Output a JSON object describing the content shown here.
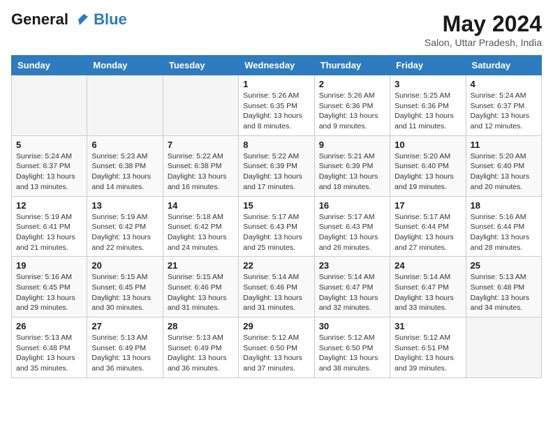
{
  "logo": {
    "line1": "General",
    "line2": "Blue"
  },
  "title": "May 2024",
  "location": "Salon, Uttar Pradesh, India",
  "days_of_week": [
    "Sunday",
    "Monday",
    "Tuesday",
    "Wednesday",
    "Thursday",
    "Friday",
    "Saturday"
  ],
  "weeks": [
    [
      {
        "day": "",
        "sunrise": "",
        "sunset": "",
        "daylight": ""
      },
      {
        "day": "",
        "sunrise": "",
        "sunset": "",
        "daylight": ""
      },
      {
        "day": "",
        "sunrise": "",
        "sunset": "",
        "daylight": ""
      },
      {
        "day": "1",
        "sunrise": "Sunrise: 5:26 AM",
        "sunset": "Sunset: 6:35 PM",
        "daylight": "Daylight: 13 hours and 8 minutes."
      },
      {
        "day": "2",
        "sunrise": "Sunrise: 5:26 AM",
        "sunset": "Sunset: 6:36 PM",
        "daylight": "Daylight: 13 hours and 9 minutes."
      },
      {
        "day": "3",
        "sunrise": "Sunrise: 5:25 AM",
        "sunset": "Sunset: 6:36 PM",
        "daylight": "Daylight: 13 hours and 11 minutes."
      },
      {
        "day": "4",
        "sunrise": "Sunrise: 5:24 AM",
        "sunset": "Sunset: 6:37 PM",
        "daylight": "Daylight: 13 hours and 12 minutes."
      }
    ],
    [
      {
        "day": "5",
        "sunrise": "Sunrise: 5:24 AM",
        "sunset": "Sunset: 6:37 PM",
        "daylight": "Daylight: 13 hours and 13 minutes."
      },
      {
        "day": "6",
        "sunrise": "Sunrise: 5:23 AM",
        "sunset": "Sunset: 6:38 PM",
        "daylight": "Daylight: 13 hours and 14 minutes."
      },
      {
        "day": "7",
        "sunrise": "Sunrise: 5:22 AM",
        "sunset": "Sunset: 6:38 PM",
        "daylight": "Daylight: 13 hours and 16 minutes."
      },
      {
        "day": "8",
        "sunrise": "Sunrise: 5:22 AM",
        "sunset": "Sunset: 6:39 PM",
        "daylight": "Daylight: 13 hours and 17 minutes."
      },
      {
        "day": "9",
        "sunrise": "Sunrise: 5:21 AM",
        "sunset": "Sunset: 6:39 PM",
        "daylight": "Daylight: 13 hours and 18 minutes."
      },
      {
        "day": "10",
        "sunrise": "Sunrise: 5:20 AM",
        "sunset": "Sunset: 6:40 PM",
        "daylight": "Daylight: 13 hours and 19 minutes."
      },
      {
        "day": "11",
        "sunrise": "Sunrise: 5:20 AM",
        "sunset": "Sunset: 6:40 PM",
        "daylight": "Daylight: 13 hours and 20 minutes."
      }
    ],
    [
      {
        "day": "12",
        "sunrise": "Sunrise: 5:19 AM",
        "sunset": "Sunset: 6:41 PM",
        "daylight": "Daylight: 13 hours and 21 minutes."
      },
      {
        "day": "13",
        "sunrise": "Sunrise: 5:19 AM",
        "sunset": "Sunset: 6:42 PM",
        "daylight": "Daylight: 13 hours and 22 minutes."
      },
      {
        "day": "14",
        "sunrise": "Sunrise: 5:18 AM",
        "sunset": "Sunset: 6:42 PM",
        "daylight": "Daylight: 13 hours and 24 minutes."
      },
      {
        "day": "15",
        "sunrise": "Sunrise: 5:17 AM",
        "sunset": "Sunset: 6:43 PM",
        "daylight": "Daylight: 13 hours and 25 minutes."
      },
      {
        "day": "16",
        "sunrise": "Sunrise: 5:17 AM",
        "sunset": "Sunset: 6:43 PM",
        "daylight": "Daylight: 13 hours and 26 minutes."
      },
      {
        "day": "17",
        "sunrise": "Sunrise: 5:17 AM",
        "sunset": "Sunset: 6:44 PM",
        "daylight": "Daylight: 13 hours and 27 minutes."
      },
      {
        "day": "18",
        "sunrise": "Sunrise: 5:16 AM",
        "sunset": "Sunset: 6:44 PM",
        "daylight": "Daylight: 13 hours and 28 minutes."
      }
    ],
    [
      {
        "day": "19",
        "sunrise": "Sunrise: 5:16 AM",
        "sunset": "Sunset: 6:45 PM",
        "daylight": "Daylight: 13 hours and 29 minutes."
      },
      {
        "day": "20",
        "sunrise": "Sunrise: 5:15 AM",
        "sunset": "Sunset: 6:45 PM",
        "daylight": "Daylight: 13 hours and 30 minutes."
      },
      {
        "day": "21",
        "sunrise": "Sunrise: 5:15 AM",
        "sunset": "Sunset: 6:46 PM",
        "daylight": "Daylight: 13 hours and 31 minutes."
      },
      {
        "day": "22",
        "sunrise": "Sunrise: 5:14 AM",
        "sunset": "Sunset: 6:46 PM",
        "daylight": "Daylight: 13 hours and 31 minutes."
      },
      {
        "day": "23",
        "sunrise": "Sunrise: 5:14 AM",
        "sunset": "Sunset: 6:47 PM",
        "daylight": "Daylight: 13 hours and 32 minutes."
      },
      {
        "day": "24",
        "sunrise": "Sunrise: 5:14 AM",
        "sunset": "Sunset: 6:47 PM",
        "daylight": "Daylight: 13 hours and 33 minutes."
      },
      {
        "day": "25",
        "sunrise": "Sunrise: 5:13 AM",
        "sunset": "Sunset: 6:48 PM",
        "daylight": "Daylight: 13 hours and 34 minutes."
      }
    ],
    [
      {
        "day": "26",
        "sunrise": "Sunrise: 5:13 AM",
        "sunset": "Sunset: 6:48 PM",
        "daylight": "Daylight: 13 hours and 35 minutes."
      },
      {
        "day": "27",
        "sunrise": "Sunrise: 5:13 AM",
        "sunset": "Sunset: 6:49 PM",
        "daylight": "Daylight: 13 hours and 36 minutes."
      },
      {
        "day": "28",
        "sunrise": "Sunrise: 5:13 AM",
        "sunset": "Sunset: 6:49 PM",
        "daylight": "Daylight: 13 hours and 36 minutes."
      },
      {
        "day": "29",
        "sunrise": "Sunrise: 5:12 AM",
        "sunset": "Sunset: 6:50 PM",
        "daylight": "Daylight: 13 hours and 37 minutes."
      },
      {
        "day": "30",
        "sunrise": "Sunrise: 5:12 AM",
        "sunset": "Sunset: 6:50 PM",
        "daylight": "Daylight: 13 hours and 38 minutes."
      },
      {
        "day": "31",
        "sunrise": "Sunrise: 5:12 AM",
        "sunset": "Sunset: 6:51 PM",
        "daylight": "Daylight: 13 hours and 39 minutes."
      },
      {
        "day": "",
        "sunrise": "",
        "sunset": "",
        "daylight": ""
      }
    ]
  ],
  "colors": {
    "header_bg": "#2e7bbf",
    "accent_blue": "#2e7bbf"
  }
}
